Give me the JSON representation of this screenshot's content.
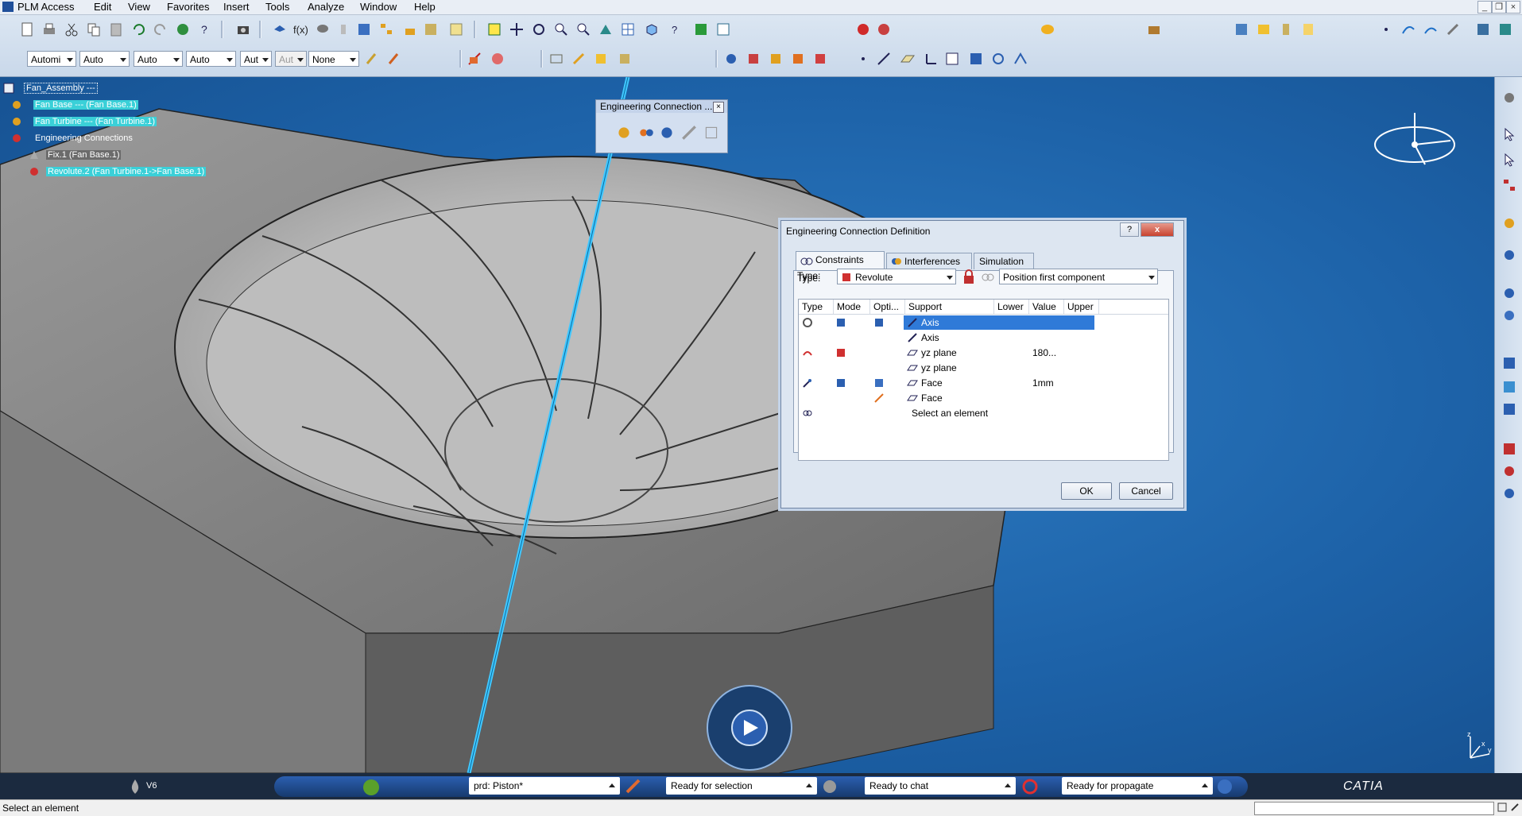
{
  "menu": {
    "app_title": "PLM Access",
    "items": [
      "Edit",
      "View",
      "Favorites",
      "Insert",
      "Tools",
      "Analyze",
      "Window",
      "Help"
    ]
  },
  "toolbar": {
    "combos": [
      "Automi",
      "Auto",
      "Auto",
      "Auto",
      "Aut",
      "Aut",
      "None"
    ]
  },
  "tree": {
    "root": "Fan_Assembly ---",
    "fan_base": "Fan Base --- (Fan Base.1)",
    "fan_turbine": "Fan Turbine --- (Fan Turbine.1)",
    "connections": "Engineering Connections",
    "fix": "Fix.1 (Fan Base.1)",
    "revolute": "Revolute.2 (Fan Turbine.1->Fan Base.1)"
  },
  "float_toolbar": {
    "title": "Engineering Connection ..."
  },
  "dialog": {
    "title": "Engineering Connection Definition",
    "help_label": "?",
    "close_label": "x",
    "tabs": [
      "Constraints",
      "Interferences",
      "Simulation"
    ],
    "type_label": "Type:",
    "type_value": "Revolute",
    "position_value": "Position first component",
    "columns": [
      "Type",
      "Mode",
      "Opti...",
      "Support",
      "Lower",
      "Value",
      "Upper"
    ],
    "rows": [
      {
        "support": "Axis",
        "value": ""
      },
      {
        "support": "Axis",
        "value": ""
      },
      {
        "support": "yz plane",
        "value": "180..."
      },
      {
        "support": "yz plane",
        "value": ""
      },
      {
        "support": "Face",
        "value": "1mm"
      },
      {
        "support": "Face",
        "value": ""
      },
      {
        "support": "Select an element",
        "value": ""
      }
    ],
    "ok_label": "OK",
    "cancel_label": "Cancel"
  },
  "status": {
    "version": "V6",
    "prd": "prd: Piston*",
    "selection": "Ready for selection",
    "chat": "Ready to chat",
    "propagate": "Ready for propagate",
    "brand": "CATIA",
    "message": "Select an element"
  },
  "compass": {
    "x": "x",
    "y": "y",
    "z": "z"
  },
  "colors": {
    "accent": "#2f7ad8",
    "tree_highlight": "#3ad0d8",
    "background": "#1d62a8"
  }
}
